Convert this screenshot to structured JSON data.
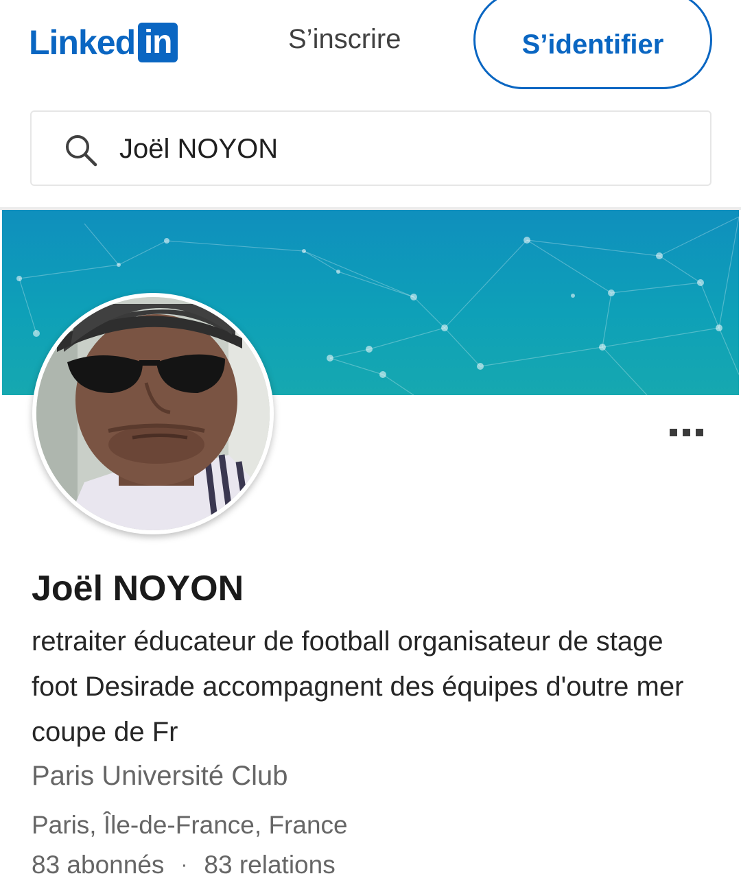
{
  "header": {
    "logo_text": "Linked",
    "logo_box_text": "in",
    "join_label": "S’inscrire",
    "signin_label": "S’identifier"
  },
  "search": {
    "value": "Joël NOYON",
    "icon": "search-icon"
  },
  "profile": {
    "name": "Joël NOYON",
    "headline": "retraiter éducateur de football organisateur de stage foot Desirade accompagnent des équipes d'outre mer coupe de Fr",
    "company": "Paris Université Club",
    "location": "Paris, Île-de-France, France",
    "followers": "83 abonnés",
    "separator": "·",
    "connections": "83 relations",
    "more_icon": "more-options-icon"
  },
  "colors": {
    "brand": "#0a66c2",
    "banner_top": "#0f8fbd",
    "banner_bottom": "#16a8b0",
    "secondary_text": "#666666"
  }
}
